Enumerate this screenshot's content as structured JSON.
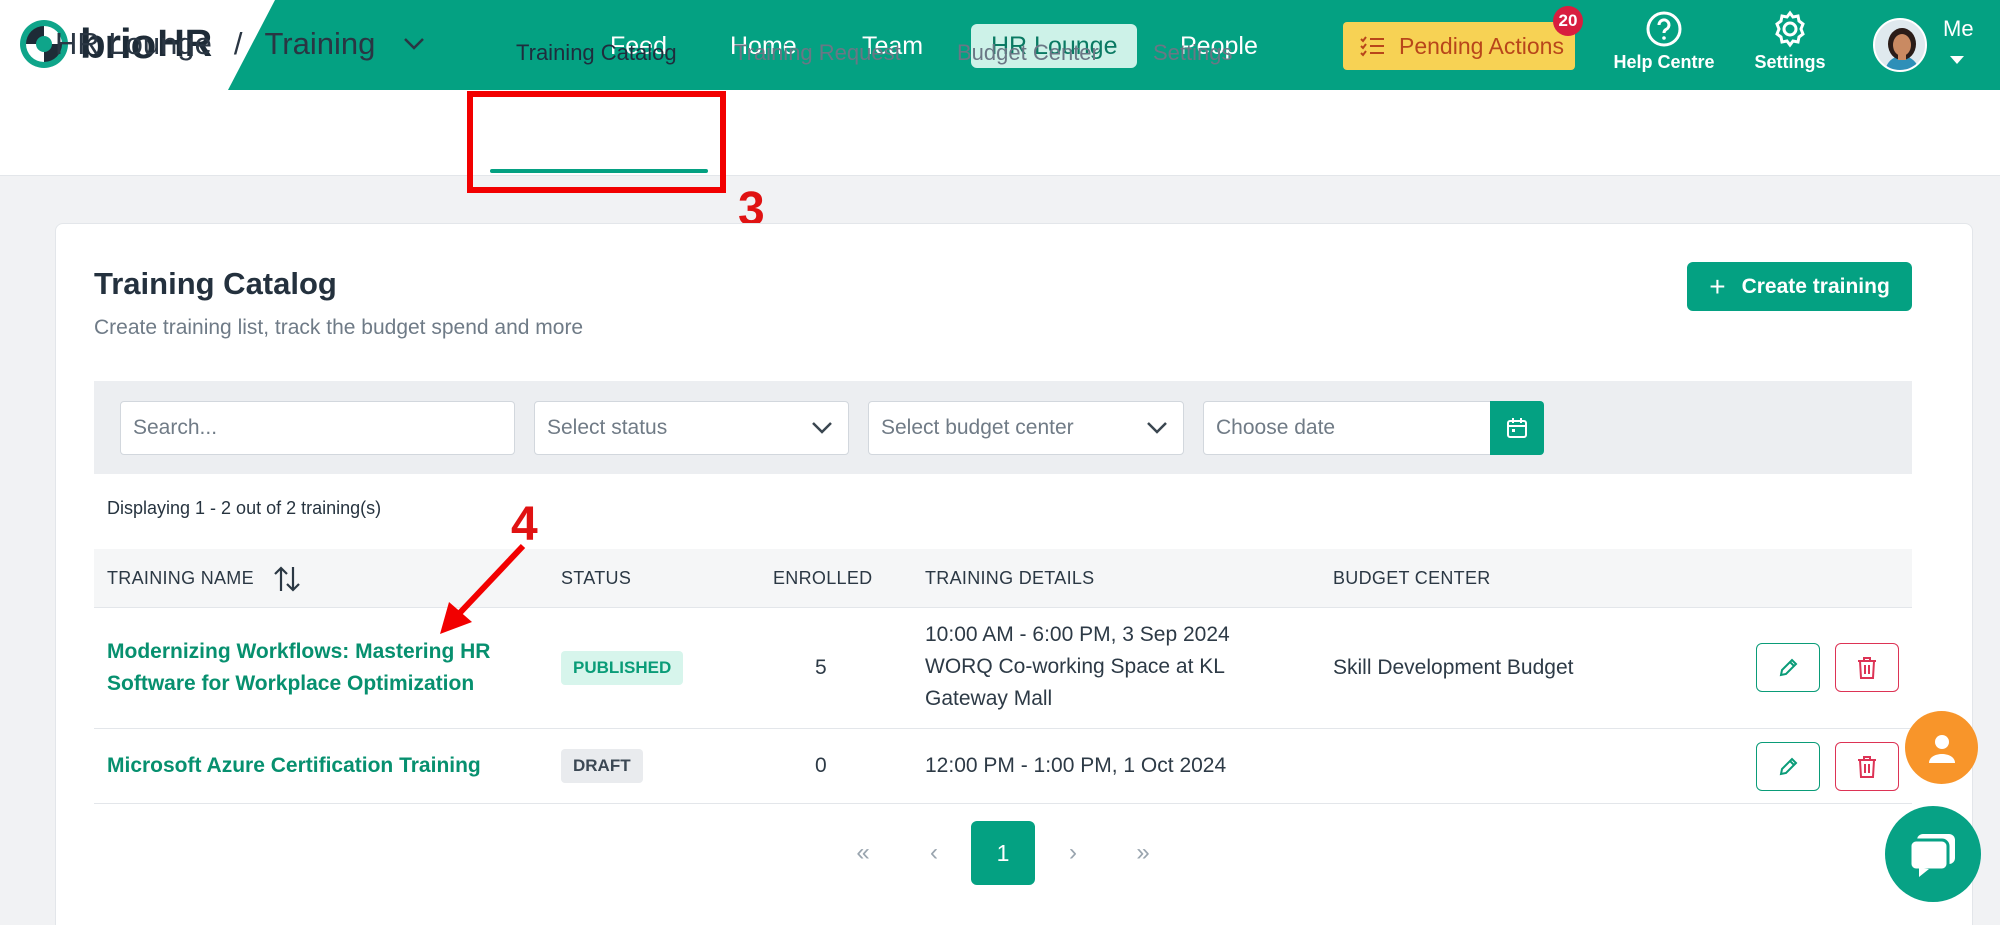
{
  "brand": {
    "name_part1": "brio",
    "name_part2": "HR"
  },
  "nav": {
    "items": [
      "Feed",
      "Home",
      "Team",
      "HR Lounge",
      "People"
    ],
    "active": "HR Lounge"
  },
  "pending_actions": {
    "label": "Pending Actions",
    "count": "20"
  },
  "help": {
    "label": "Help Centre"
  },
  "settings_top": {
    "label": "Settings"
  },
  "user": {
    "label": "Me"
  },
  "breadcrumb": {
    "section": "HR Lounge",
    "separator": "/",
    "page": "Training"
  },
  "subtabs": [
    "Training Catalog",
    "Training Request",
    "Budget Center",
    "Settings"
  ],
  "annotations": {
    "step3": "3",
    "step4": "4"
  },
  "catalog": {
    "title": "Training Catalog",
    "subtitle": "Create training list, track the budget spend and more",
    "create_label": "Create training"
  },
  "filters": {
    "search_placeholder": "Search...",
    "status_placeholder": "Select status",
    "budget_placeholder": "Select budget center",
    "date_placeholder": "Choose date"
  },
  "display_count": "Displaying 1 - 2 out of 2 training(s)",
  "table": {
    "headers": [
      "TRAINING NAME",
      "STATUS",
      "ENROLLED",
      "TRAINING DETAILS",
      "BUDGET CENTER"
    ],
    "rows": [
      {
        "name_line1": "Modernizing Workflows: Mastering HR",
        "name_line2": "Software for Workplace Optimization",
        "status": "PUBLISHED",
        "enrolled": "5",
        "details_line1": "10:00 AM - 6:00 PM, 3 Sep 2024",
        "details_line2": "WORQ Co-working Space at KL",
        "details_line3": "Gateway Mall",
        "budget": "Skill Development Budget"
      },
      {
        "name_line1": "Microsoft Azure Certification Training",
        "status": "DRAFT",
        "enrolled": "0",
        "details_line1": "12:00 PM - 1:00 PM, 1 Oct 2024",
        "budget": ""
      }
    ]
  },
  "pagination": {
    "first": "«",
    "prev": "‹",
    "current": "1",
    "next": "›",
    "last": "»"
  },
  "colors": {
    "brand": "#04a182",
    "pending": "#f7d254",
    "badge": "#d81e3f",
    "annotation": "#f20000",
    "fab_user": "#f8952a"
  }
}
